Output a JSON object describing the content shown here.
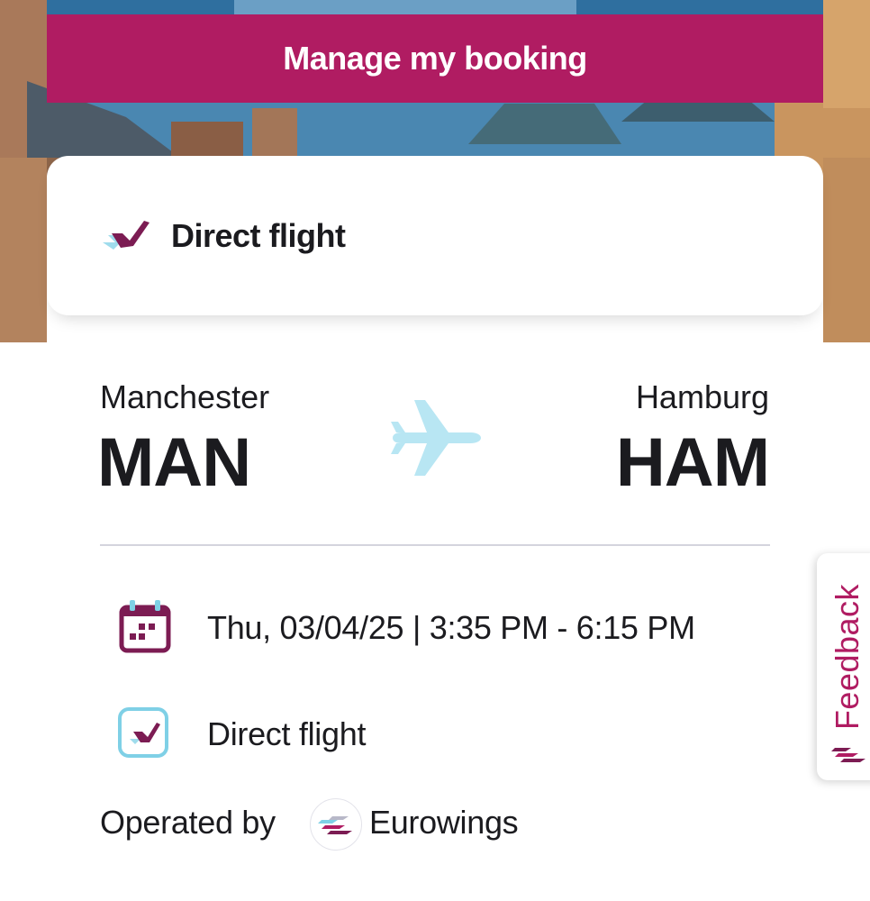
{
  "header": {
    "manage_booking_label": "Manage my booking"
  },
  "flight_card": {
    "title": "Direct flight",
    "origin": {
      "city": "Manchester",
      "code": "MAN"
    },
    "destination": {
      "city": "Hamburg",
      "code": "HAM"
    },
    "schedule": "Thu, 03/04/25 | 3:35 PM - 6:15 PM",
    "flight_type": "Direct flight",
    "operated_by_label": "Operated by",
    "airline": "Eurowings"
  },
  "feedback": {
    "label": "Feedback"
  },
  "icons": {
    "header": "direct-flight-icon",
    "route": "airplane-icon",
    "schedule": "calendar-icon",
    "flight_type": "direct-flight-icon",
    "airline": "eurowings-logo",
    "feedback": "eurowings-logo"
  },
  "colors": {
    "brand": "#b01c62",
    "brand_dark": "#7c1c53",
    "accent_light_blue": "#b8e6f3",
    "text": "#1b1b1f"
  }
}
